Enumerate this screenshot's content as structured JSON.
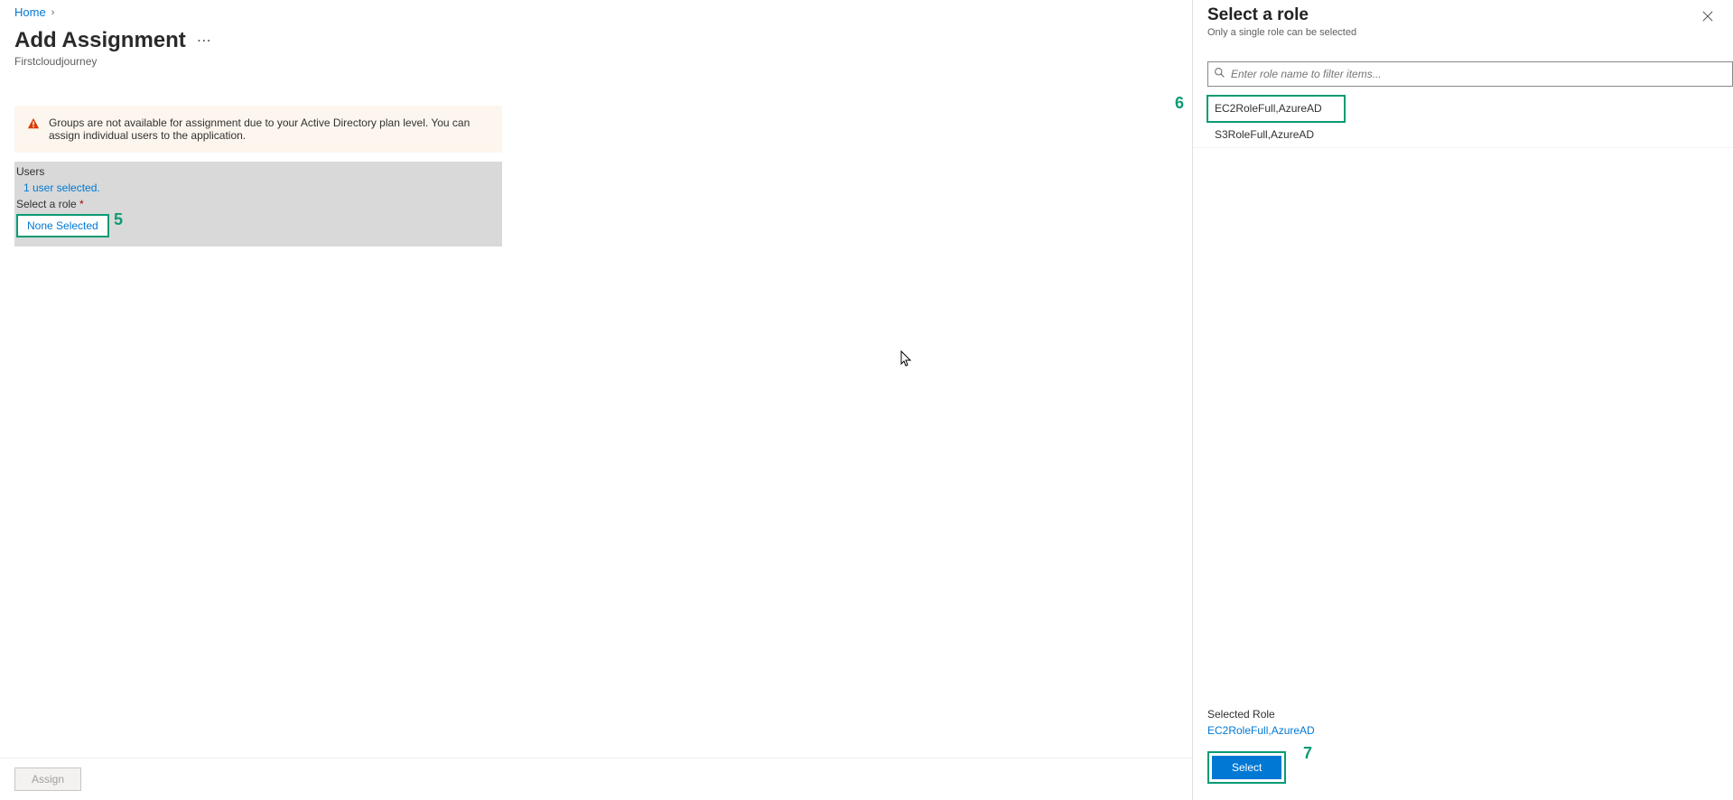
{
  "breadcrumb": {
    "home": "Home"
  },
  "page": {
    "title": "Add Assignment",
    "subtitle": "Firstcloudjourney"
  },
  "warning": "Groups are not available for assignment due to your Active Directory plan level. You can assign individual users to the application.",
  "form": {
    "users_label": "Users",
    "users_value": "1 user selected.",
    "role_label": "Select a role",
    "role_value": "None Selected"
  },
  "annotations": {
    "a5": "5",
    "a6": "6",
    "a7": "7"
  },
  "footer": {
    "assign": "Assign"
  },
  "panel": {
    "title": "Select a role",
    "subtitle": "Only a single role can be selected",
    "search_placeholder": "Enter role name to filter items...",
    "roles": {
      "r0": "EC2RoleFull,AzureAD",
      "r1": "S3RoleFull,AzureAD"
    },
    "selected_label": "Selected Role",
    "selected_value": "EC2RoleFull,AzureAD",
    "select_btn": "Select"
  }
}
